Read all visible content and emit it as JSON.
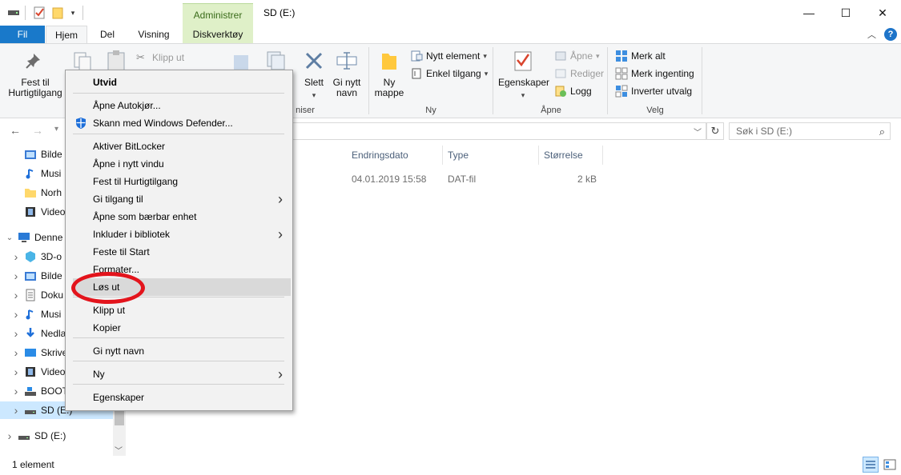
{
  "window": {
    "title": "SD (E:)",
    "context_tab_header": "Administrer",
    "minimize": "—",
    "maximize": "☐",
    "close": "✕"
  },
  "ribbon_tabs": [
    "Fil",
    "Hjem",
    "Del",
    "Visning",
    "Diskverktøy"
  ],
  "ribbon": {
    "pin_quick_access": "Fest til Hurtigtilgang",
    "cut": "Klipp ut",
    "delete": "Slett",
    "rename": "Gi nytt navn",
    "new_folder": "Ny mappe",
    "new_item": "Nytt element",
    "easy_access": "Enkel tilgang",
    "properties": "Egenskaper",
    "open": "Åpne",
    "edit": "Rediger",
    "history": "Logg",
    "select_all": "Merk alt",
    "select_none": "Merk ingenting",
    "invert_selection": "Inverter utvalg",
    "group_organize_partial": "niser",
    "group_new": "Ny",
    "group_open": "Åpne",
    "group_select": "Velg"
  },
  "address": {
    "search_placeholder": "Søk i SD (E:)"
  },
  "nav_pane": [
    {
      "label": "Bilde",
      "icon": "pictures-icon",
      "indent": 1,
      "expander": ""
    },
    {
      "label": "Musi",
      "icon": "music-icon",
      "indent": 1,
      "expander": ""
    },
    {
      "label": "Norh",
      "icon": "folder-icon",
      "indent": 1,
      "expander": ""
    },
    {
      "label": "Video",
      "icon": "videos-icon",
      "indent": 1,
      "expander": ""
    },
    {
      "label": "Denne",
      "icon": "this-pc-icon",
      "indent": 0,
      "expander": "expanded"
    },
    {
      "label": "3D-o",
      "icon": "3d-objects-icon",
      "indent": 1,
      "expander": "collapsed"
    },
    {
      "label": "Bilde",
      "icon": "pictures-icon",
      "indent": 1,
      "expander": "collapsed"
    },
    {
      "label": "Doku",
      "icon": "documents-icon",
      "indent": 1,
      "expander": "collapsed"
    },
    {
      "label": "Musi",
      "icon": "music-icon",
      "indent": 1,
      "expander": "collapsed"
    },
    {
      "label": "Nedla",
      "icon": "downloads-icon",
      "indent": 1,
      "expander": "collapsed"
    },
    {
      "label": "Skrive",
      "icon": "desktop-icon",
      "indent": 1,
      "expander": "collapsed"
    },
    {
      "label": "Video",
      "icon": "videos-icon",
      "indent": 1,
      "expander": "collapsed"
    },
    {
      "label": "BOOT",
      "icon": "boot-drive-icon",
      "indent": 1,
      "expander": "collapsed"
    },
    {
      "label": "SD (E:)",
      "icon": "sd-drive-icon",
      "indent": 1,
      "expander": "collapsed",
      "selected": true
    },
    {
      "label": "SD (E:)",
      "icon": "sd-drive-icon",
      "indent": 0,
      "expander": "collapsed"
    }
  ],
  "file_list": {
    "columns": [
      "Endringsdato",
      "Type",
      "Størrelse"
    ],
    "rows": [
      {
        "date": "04.01.2019 15:58",
        "type": "DAT-fil",
        "size": "2 kB"
      }
    ]
  },
  "status_bar": {
    "item_count": "1 element"
  },
  "context_menu": {
    "items": [
      {
        "label": "Utvid",
        "bold": true
      },
      {
        "separator": true
      },
      {
        "label": "Åpne Autokjør..."
      },
      {
        "label": "Skann med Windows Defender...",
        "icon": "windows-defender-icon"
      },
      {
        "separator": true
      },
      {
        "label": "Aktiver BitLocker"
      },
      {
        "label": "Åpne i nytt vindu"
      },
      {
        "label": "Fest til Hurtigtilgang"
      },
      {
        "label": "Gi tilgang til",
        "submenu": true
      },
      {
        "label": "Åpne som bærbar enhet"
      },
      {
        "label": "Inkluder i bibliotek",
        "submenu": true
      },
      {
        "label": "Feste til Start"
      },
      {
        "label": "Formater..."
      },
      {
        "label": "Løs ut",
        "hover": true
      },
      {
        "separator": true
      },
      {
        "label": "Klipp ut"
      },
      {
        "label": "Kopier"
      },
      {
        "separator": true
      },
      {
        "label": "Gi nytt navn"
      },
      {
        "separator": true
      },
      {
        "label": "Ny",
        "submenu": true
      },
      {
        "separator": true
      },
      {
        "label": "Egenskaper"
      }
    ],
    "highlight_color": "#e3141c"
  },
  "colors": {
    "accent": "#1979ca",
    "context_tab": "#dff0c8",
    "selection": "#cce8ff"
  }
}
